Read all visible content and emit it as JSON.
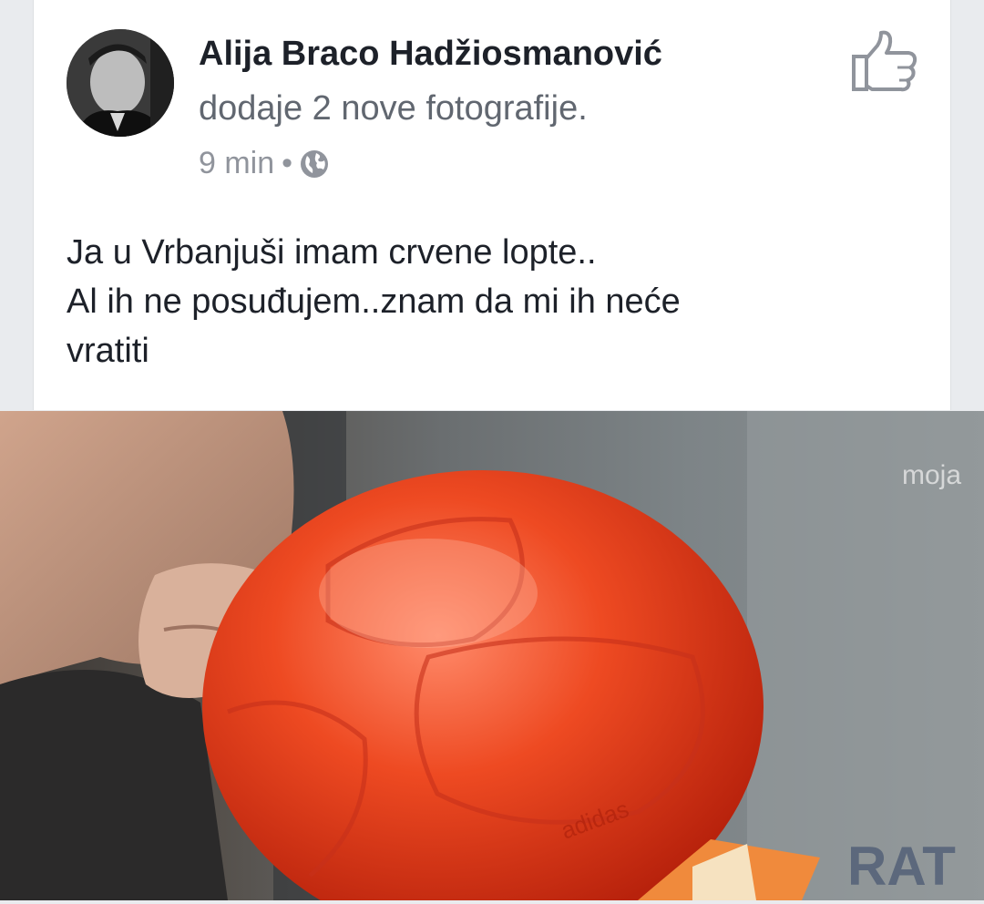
{
  "post": {
    "author": "Alija Braco Hadžiosmanović",
    "action": "dodaje 2 nove fotografije.",
    "time": "9 min",
    "separator": "•",
    "privacy_icon": "globe-icon",
    "like_icon": "thumbs-up-icon",
    "text_lines": [
      "Ja u Vrbanjuši imam crvene lopte..",
      "Al ih ne posuđujem..znam da mi ih neće",
      "vratiti"
    ]
  },
  "photo": {
    "watermark": "moja",
    "ball_brand": "adidas",
    "corner_text": "RAT"
  },
  "colors": {
    "background": "#e9ebee",
    "card": "#ffffff",
    "author": "#1d2129",
    "secondary": "#616770",
    "meta": "#90949c",
    "ball": "#e8451f"
  }
}
